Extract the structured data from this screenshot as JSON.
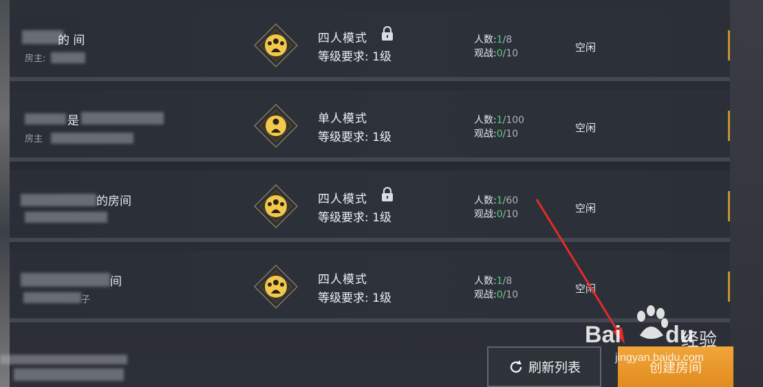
{
  "rooms": [
    {
      "name": "的 间",
      "host": "房主:",
      "mode": "四人模式",
      "locked": true,
      "level": "等级要求: 1级",
      "players_label": "人数:",
      "players_cur": "1",
      "players_max": "/8",
      "spec_label": "观战:",
      "spec_cur": "0",
      "spec_max": "/10",
      "status": "空闲",
      "badge": "group-icon"
    },
    {
      "name": "是",
      "host": "房主",
      "mode": "单人模式",
      "locked": false,
      "level": "等级要求: 1级",
      "players_label": "人数:",
      "players_cur": "1",
      "players_max": "/100",
      "spec_label": "观战:",
      "spec_cur": "0",
      "spec_max": "/10",
      "status": "空闲",
      "badge": "solo-icon"
    },
    {
      "name": "的房间",
      "host": "",
      "mode": "四人模式",
      "locked": true,
      "level": "等级要求: 1级",
      "players_label": "人数:",
      "players_cur": "1",
      "players_max": "/60",
      "spec_label": "观战:",
      "spec_cur": "0",
      "spec_max": "/10",
      "status": "空闲",
      "badge": "group-icon"
    },
    {
      "name": "间",
      "host": "子",
      "mode": "四人模式",
      "locked": false,
      "level": "等级要求: 1级",
      "players_label": "人数:",
      "players_cur": "1",
      "players_max": "/8",
      "spec_label": "观战:",
      "spec_cur": "0",
      "spec_max": "/10",
      "status": "空闲",
      "badge": "group-icon"
    }
  ],
  "buttons": {
    "refresh": "刷新列表",
    "create": "创建房间"
  },
  "watermark": {
    "brand_left": "Bai",
    "brand_right": "du",
    "suffix": "经验",
    "url": "jingyan.baidu.com"
  },
  "colors": {
    "accent": "#e9a23b",
    "green": "#4fd07a",
    "badge_gold": "#f2c94c"
  }
}
